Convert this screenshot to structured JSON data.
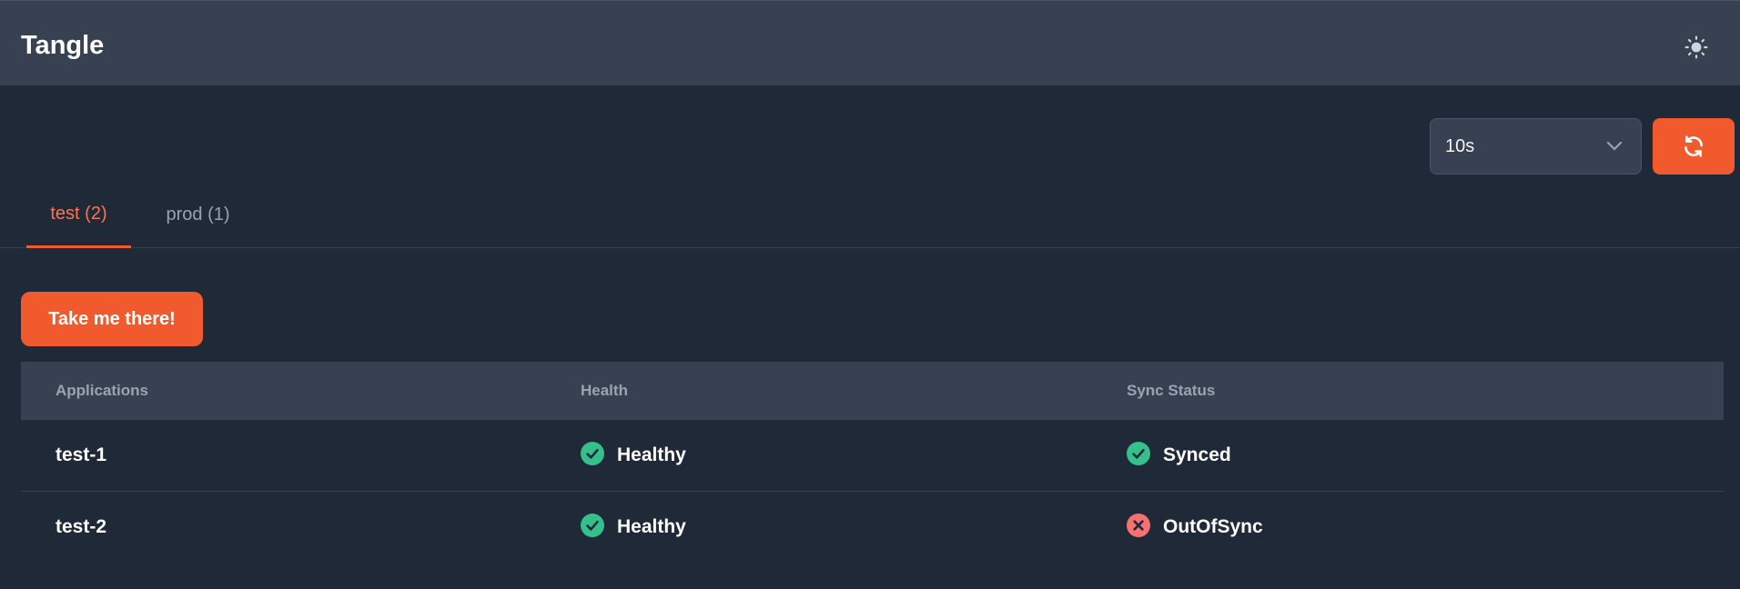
{
  "header": {
    "title": "Tangle",
    "theme_icon": "sun-icon"
  },
  "controls": {
    "interval_selected": "10s",
    "refresh_icon": "refresh-icon",
    "accent_color": "#f05a2c"
  },
  "tabs": [
    {
      "label": "test (2)",
      "active": true
    },
    {
      "label": "prod (1)",
      "active": false
    }
  ],
  "action_button": {
    "label": "Take me there!"
  },
  "table": {
    "columns": [
      "Applications",
      "Health",
      "Sync Status"
    ],
    "rows": [
      {
        "name": "test-1",
        "health": "Healthy",
        "health_icon": "check-circle-icon",
        "sync": "Synced",
        "sync_icon": "check-circle-icon"
      },
      {
        "name": "test-2",
        "health": "Healthy",
        "health_icon": "check-circle-icon",
        "sync": "OutOfSync",
        "sync_icon": "x-circle-icon"
      }
    ]
  },
  "status_colors": {
    "ok": "#34c08b",
    "error": "#f87171"
  }
}
